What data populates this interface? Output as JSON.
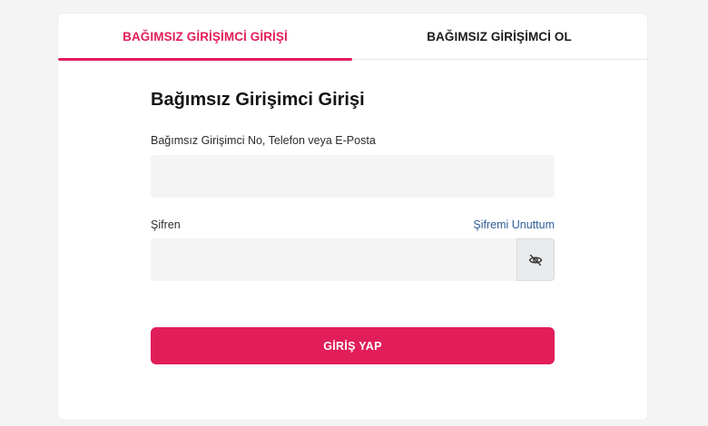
{
  "tabs": [
    {
      "label": "BAĞIMSIZ GİRİŞİMCİ GİRİŞİ",
      "active": true
    },
    {
      "label": "BAĞIMSIZ GİRİŞİMCİ OL",
      "active": false
    }
  ],
  "form": {
    "title": "Bağımsız Girişimci Girişi",
    "identifier": {
      "label": "Bağımsız Girişimci No, Telefon veya E-Posta",
      "value": "",
      "placeholder": ""
    },
    "password": {
      "label": "Şifren",
      "value": "",
      "placeholder": "",
      "toggle_icon": "eye-slash-icon"
    },
    "forgot_label": "Şifremi Unuttum",
    "submit_label": "GİRİŞ YAP"
  },
  "colors": {
    "accent": "#e11d5a",
    "link": "#2e5d99",
    "input_bg": "#f4f4f5",
    "page_bg": "#f4f4f5"
  }
}
